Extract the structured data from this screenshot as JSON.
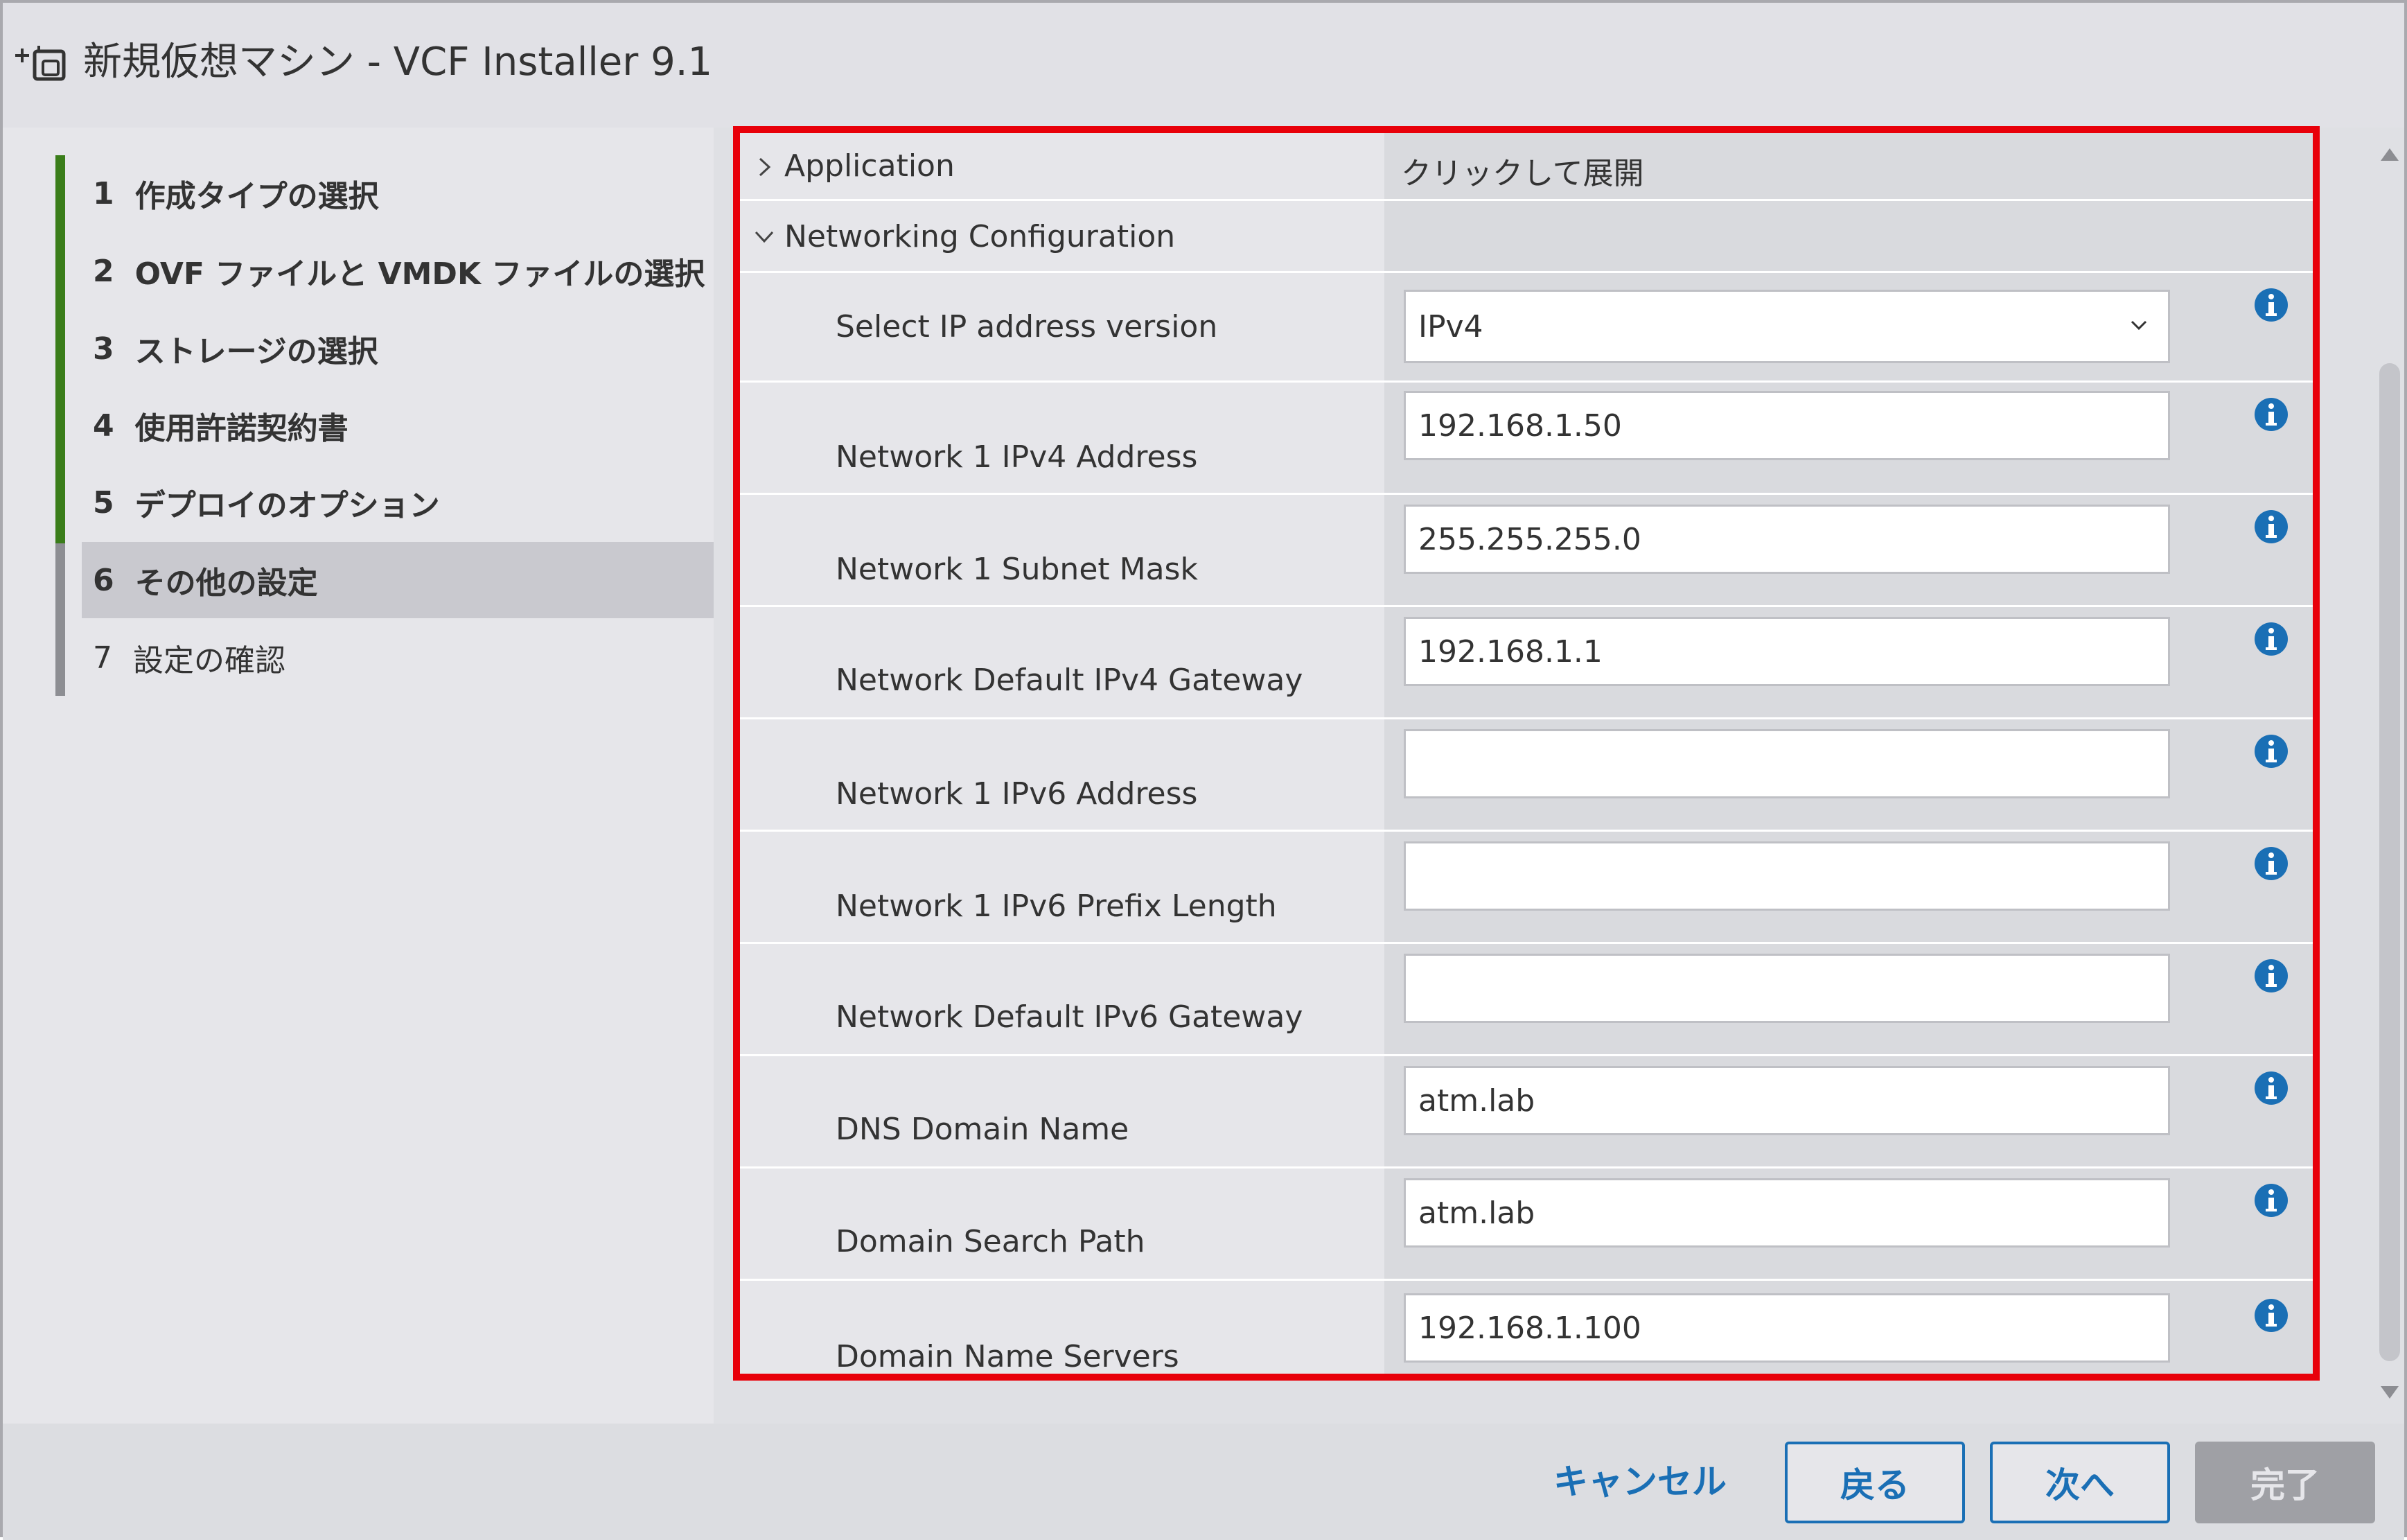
{
  "window": {
    "title": "新規仮想マシン - VCF Installer 9.1"
  },
  "steps": [
    {
      "num": "1",
      "label": "作成タイプの選択"
    },
    {
      "num": "2",
      "label": "OVF ファイルと VMDK ファイルの選択"
    },
    {
      "num": "3",
      "label": "ストレージの選択"
    },
    {
      "num": "4",
      "label": "使用許諾契約書"
    },
    {
      "num": "5",
      "label": "デプロイのオプション"
    },
    {
      "num": "6",
      "label": "その他の設定"
    },
    {
      "num": "7",
      "label": "設定の確認"
    }
  ],
  "active_step": "6",
  "sections": {
    "application": {
      "label": "Application",
      "value": "クリックして展開"
    },
    "networking": {
      "label": "Networking Configuration"
    }
  },
  "fields": [
    {
      "label": "Select IP address version",
      "value": "IPv4"
    },
    {
      "label": "Network 1 IPv4 Address",
      "value": "192.168.1.50"
    },
    {
      "label": "Network 1 Subnet Mask",
      "value": "255.255.255.0"
    },
    {
      "label": "Network Default IPv4 Gateway",
      "value": "192.168.1.1"
    },
    {
      "label": "Network 1 IPv6 Address",
      "value": ""
    },
    {
      "label": "Network 1 IPv6 Prefix Length",
      "value": ""
    },
    {
      "label": "Network Default IPv6 Gateway",
      "value": ""
    },
    {
      "label": "DNS Domain Name",
      "value": "atm.lab"
    },
    {
      "label": "Domain Search Path",
      "value": "atm.lab"
    },
    {
      "label": "Domain Name Servers",
      "value": "192.168.1.100"
    }
  ],
  "footer": {
    "cancel": "キャンセル",
    "back": "戻る",
    "next": "次へ",
    "finish": "完了"
  },
  "colors": {
    "accent": "#1a6fb5",
    "step_complete": "#3a7d1a",
    "highlight": "#e8000a",
    "info": "#1a6fb5"
  },
  "icons": {
    "title": "deploy-ovf-icon",
    "info": "info-icon",
    "collapsed": "chevron-right-icon",
    "expanded": "chevron-down-icon",
    "select": "chevron-down-icon"
  }
}
